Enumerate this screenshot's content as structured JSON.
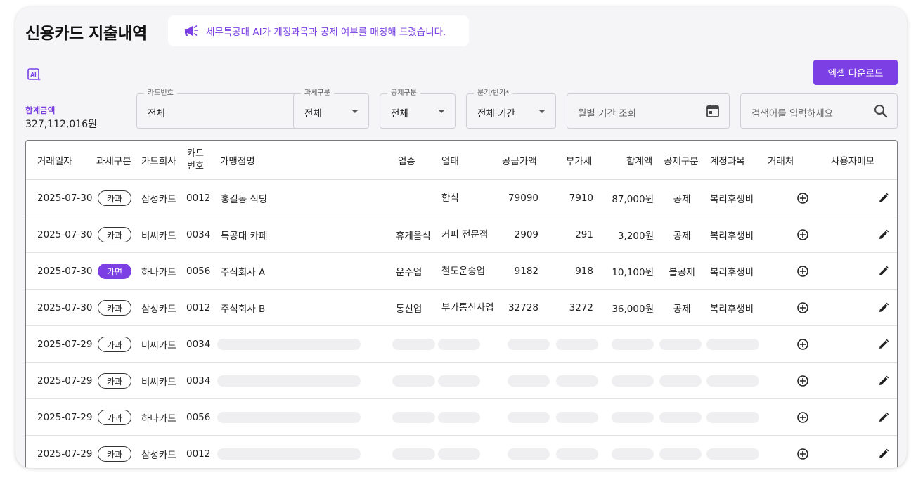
{
  "page": {
    "title": "신용카드 지출내역",
    "notice": "세무특공대 AI가 계정과목과 공제 여부를 매칭해 드렸습니다.",
    "excel_button": "엑셀 다운로드",
    "total_label": "합계금액",
    "total_value": "327,112,016원"
  },
  "filters": {
    "card_number": {
      "label": "카드번호",
      "value": "전체"
    },
    "tax_type": {
      "label": "과세구분",
      "value": "전체"
    },
    "deduction_type": {
      "label": "공제구분",
      "value": "전체"
    },
    "period": {
      "label": "분기/반기*",
      "value": "전체 기간"
    },
    "monthly": {
      "placeholder": "월별 기간 조회"
    },
    "search": {
      "placeholder": "검색어를 입력하세요"
    }
  },
  "table": {
    "headers": {
      "date": "거래일자",
      "tax_type": "과세구분",
      "card_company": "카드회사",
      "card_no_1": "카드",
      "card_no_2": "번호",
      "merchant": "가맹점명",
      "industry": "업종",
      "business": "업태",
      "supply": "공급가액",
      "vat": "부가세",
      "total": "합계액",
      "deduction": "공제구분",
      "account": "계정과목",
      "vendor": "거래처",
      "memo": "사용자메모"
    },
    "rows": [
      {
        "date": "2025-07-30",
        "tax": "카과",
        "tax_filled": false,
        "company": "삼성카드",
        "card_no": "0012",
        "merchant": "홍길동 식당",
        "industry": "",
        "business": "한식",
        "supply": "79090",
        "vat": "7910",
        "total": "87,000원",
        "deduction": "공제",
        "account": "복리후생비",
        "loading": false
      },
      {
        "date": "2025-07-30",
        "tax": "카과",
        "tax_filled": false,
        "company": "비씨카드",
        "card_no": "0034",
        "merchant": "특공대 카페",
        "industry": "휴게음식",
        "business": "커피 전문점",
        "supply": "2909",
        "vat": "291",
        "total": "3,200원",
        "deduction": "공제",
        "account": "복리후생비",
        "loading": false
      },
      {
        "date": "2025-07-30",
        "tax": "카면",
        "tax_filled": true,
        "company": "하나카드",
        "card_no": "0056",
        "merchant": "주식회사 A",
        "industry": "운수업",
        "business": "철도운송업",
        "supply": "9182",
        "vat": "918",
        "total": "10,100원",
        "deduction": "불공제",
        "account": "복리후생비",
        "loading": false
      },
      {
        "date": "2025-07-30",
        "tax": "카과",
        "tax_filled": false,
        "company": "삼성카드",
        "card_no": "0012",
        "merchant": "주식회사 B",
        "industry": "통신업",
        "business": "부가통신사업",
        "supply": "32728",
        "vat": "3272",
        "total": "36,000원",
        "deduction": "공제",
        "account": "복리후생비",
        "loading": false
      },
      {
        "date": "2025-07-29",
        "tax": "카과",
        "tax_filled": false,
        "company": "비씨카드",
        "card_no": "0034",
        "loading": true
      },
      {
        "date": "2025-07-29",
        "tax": "카과",
        "tax_filled": false,
        "company": "비씨카드",
        "card_no": "0034",
        "loading": true
      },
      {
        "date": "2025-07-29",
        "tax": "카과",
        "tax_filled": false,
        "company": "하나카드",
        "card_no": "0056",
        "loading": true
      },
      {
        "date": "2025-07-29",
        "tax": "카과",
        "tax_filled": false,
        "company": "삼성카드",
        "card_no": "0012",
        "loading": true
      }
    ]
  },
  "colors": {
    "accent": "#7b3fe4",
    "skeleton": "#efeff1"
  },
  "icons": {
    "notice": "megaphone-icon",
    "ai": "ai-image-icon",
    "calendar": "calendar-icon",
    "search": "search-icon",
    "vendor": "add-circle-icon",
    "memo": "pencil-icon"
  }
}
